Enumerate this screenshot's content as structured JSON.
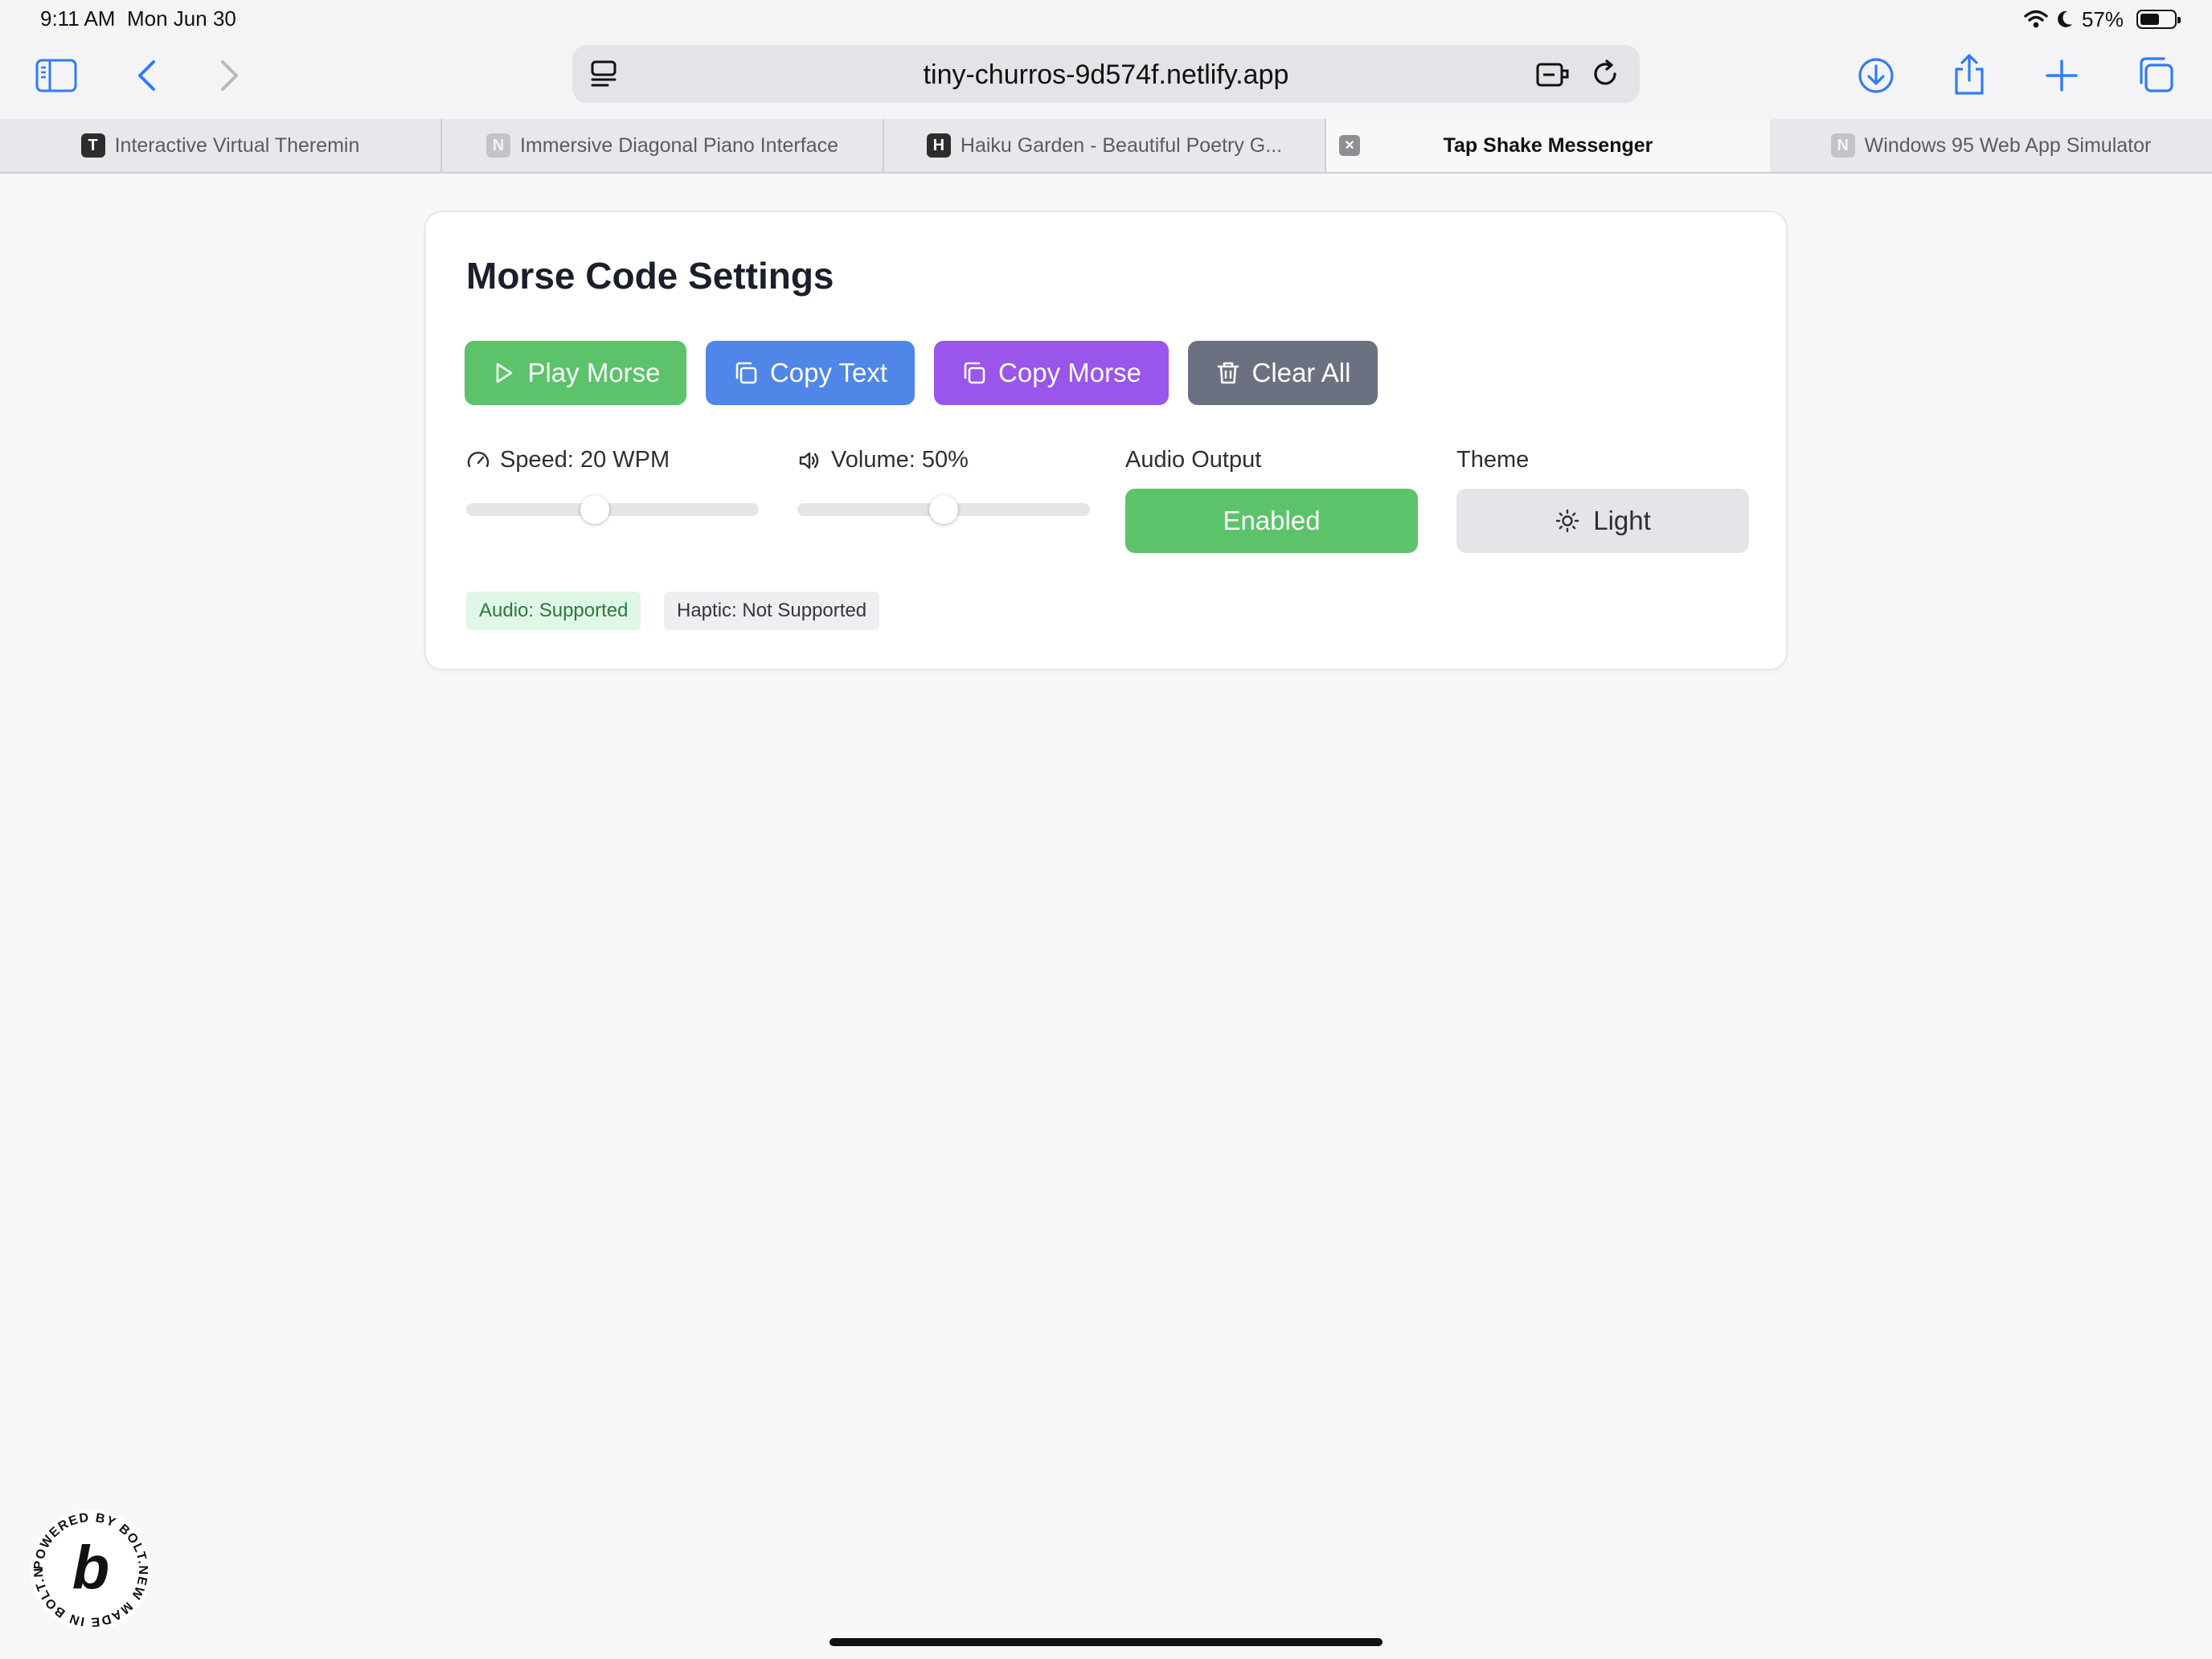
{
  "status_bar": {
    "time": "9:11 AM",
    "date": "Mon Jun 30",
    "battery_text": "57%",
    "battery_level": 0.57
  },
  "browser": {
    "url": "tiny-churros-9d574f.netlify.app",
    "toolbar_icons": [
      "sidebar-icon",
      "back-icon",
      "forward-icon",
      "reader-icon",
      "extension-icon",
      "reload-icon",
      "download-icon",
      "share-icon",
      "new-tab-icon",
      "tabs-overview-icon"
    ],
    "tabs": [
      {
        "favicon": "T",
        "label": "Interactive Virtual Theremin",
        "active": false
      },
      {
        "favicon": "N",
        "label": "Immersive Diagonal Piano Interface",
        "active": false
      },
      {
        "favicon": "H",
        "label": "Haiku Garden - Beautiful Poetry G...",
        "active": false
      },
      {
        "favicon": "",
        "label": "Tap Shake Messenger",
        "active": true
      },
      {
        "favicon": "N",
        "label": "Windows 95 Web App Simulator",
        "active": false
      }
    ]
  },
  "settings": {
    "title": "Morse Code Settings",
    "buttons": {
      "play": "Play Morse",
      "copy_text": "Copy Text",
      "copy_morse": "Copy Morse",
      "clear": "Clear All"
    },
    "speed": {
      "label": "Speed: 20 WPM",
      "value": 20,
      "min": 5,
      "max": 50,
      "position": 0.44
    },
    "volume": {
      "label": "Volume: 50%",
      "value": 50,
      "min": 0,
      "max": 100,
      "position": 0.5
    },
    "audio_output": {
      "label": "Audio Output",
      "value": "Enabled"
    },
    "theme": {
      "label": "Theme",
      "value": "Light"
    },
    "badges": {
      "audio": "Audio: Supported",
      "haptic": "Haptic: Not Supported"
    }
  },
  "bolt_badge": {
    "text": "POWERED BY BOLT.NEW MADE IN BOLT.NEW",
    "letter": "b"
  },
  "colors": {
    "play": "#5cc36a",
    "copy_text": "#4f86e8",
    "copy_morse": "#9a55ea",
    "clear": "#6b7180",
    "ios_blue": "#2f7cf6"
  }
}
